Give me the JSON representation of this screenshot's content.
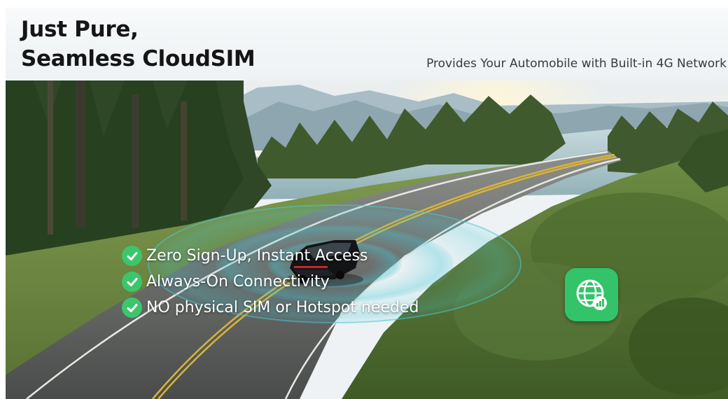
{
  "header": {
    "headline_line1": "Just Pure,",
    "headline_line2": "Seamless CloudSIM",
    "subheadline": "Provides Your Automobile with Built-in 4G Network"
  },
  "features": [
    {
      "text": "Zero Sign-Up, Instant Access",
      "icon": "check-circle-icon"
    },
    {
      "text": "Always-On Connectivity",
      "icon": "check-circle-icon"
    },
    {
      "text": "NO physical SIM or Hotspot needed",
      "icon": "check-circle-icon"
    }
  ],
  "badge": {
    "icon": "globe-signal-icon"
  },
  "colors": {
    "accent_green": "#3cc66b",
    "badge_green": "#33c46a",
    "signal_teal": "#43c8d6",
    "headline": "#151515"
  }
}
